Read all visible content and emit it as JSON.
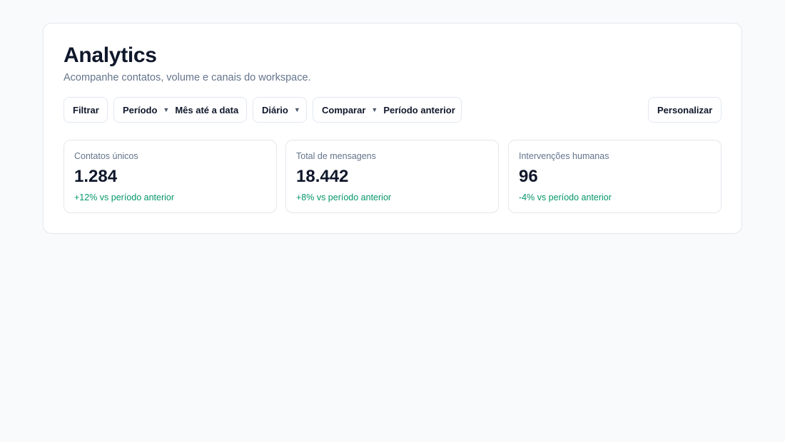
{
  "header": {
    "title": "Analytics",
    "subtitle": "Acompanhe contatos, volume e canais do workspace."
  },
  "toolbar": {
    "filter_label": "Filtrar",
    "period": {
      "label": "Período",
      "value": "Mês até a data",
      "icon": "caret-down-icon"
    },
    "granularity": {
      "value": "Diário",
      "icon": "caret-down-icon"
    },
    "compare": {
      "label": "Comparar",
      "value": "Período anterior",
      "icon": "caret-down-icon"
    },
    "customize_label": "Personalizar"
  },
  "metrics": [
    {
      "label": "Contatos únicos",
      "value": "1.284",
      "delta": "+12% vs período anterior"
    },
    {
      "label": "Total de mensagens",
      "value": "18.442",
      "delta": "+8% vs período anterior"
    },
    {
      "label": "Intervenções humanas",
      "value": "96",
      "delta": "-4% vs período anterior"
    }
  ],
  "colors": {
    "background": "#f8fafc",
    "delta": "#059669",
    "muted_text": "#64748b",
    "primary_text": "#0f172a"
  }
}
